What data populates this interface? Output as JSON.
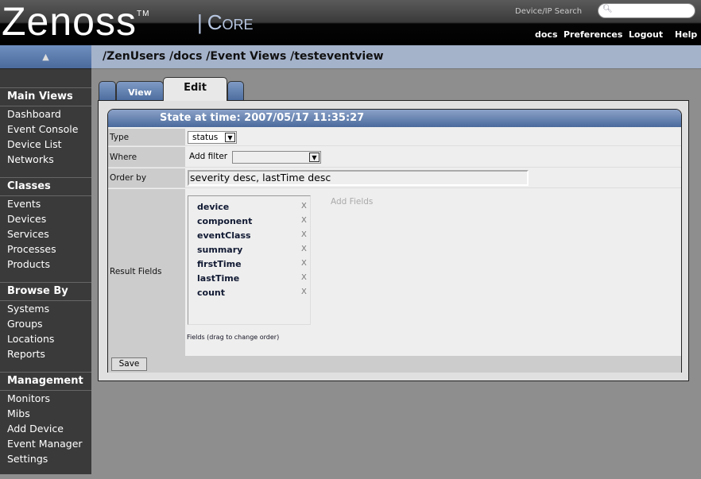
{
  "header": {
    "logo": "Zenoss",
    "trademark": "TM",
    "product": "Core",
    "search_label": "Device/IP Search",
    "search_placeholder": "",
    "links": [
      "docs",
      "Preferences",
      "Logout",
      "Help"
    ]
  },
  "breadcrumb": "/ZenUsers /docs /Event Views /testeventview",
  "sidebar": {
    "collapse_icon": "triangle-up-icon",
    "sections": [
      {
        "title": "Main Views",
        "items": [
          "Dashboard",
          "Event Console",
          "Device List",
          "Networks"
        ]
      },
      {
        "title": "Classes",
        "items": [
          "Events",
          "Devices",
          "Services",
          "Processes",
          "Products"
        ]
      },
      {
        "title": "Browse By",
        "items": [
          "Systems",
          "Groups",
          "Locations",
          "Reports"
        ]
      },
      {
        "title": "Management",
        "items": [
          "Monitors",
          "Mibs",
          "Add Device",
          "Event Manager",
          "Settings"
        ]
      }
    ]
  },
  "tabs": [
    {
      "label": "View",
      "active": false
    },
    {
      "label": "Edit",
      "active": true
    }
  ],
  "form": {
    "title": "State at time: 2007/05/17 11:35:27",
    "type_label": "Type",
    "type_value": "status",
    "where_label": "Where",
    "add_filter_label": "Add filter",
    "add_filter_value": "",
    "order_label": "Order by",
    "order_value": "severity desc, lastTime desc",
    "result_label": "Result Fields",
    "result_fields": [
      "device",
      "component",
      "eventClass",
      "summary",
      "firstTime",
      "lastTime",
      "count"
    ],
    "remove_glyph": "X",
    "add_fields_label": "Add Fields",
    "fields_hint": "Fields (drag to change order)",
    "save_label": "Save"
  }
}
